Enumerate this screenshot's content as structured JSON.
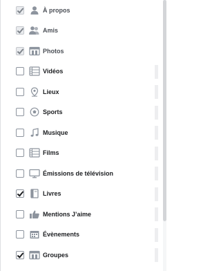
{
  "items": [
    {
      "label": "À propos",
      "checked": true,
      "locked": true,
      "icon": "person-icon"
    },
    {
      "label": "Amis",
      "checked": true,
      "locked": true,
      "icon": "friends-icon"
    },
    {
      "label": "Photos",
      "checked": true,
      "locked": true,
      "icon": "photos-icon"
    },
    {
      "label": "Vidéos",
      "checked": false,
      "locked": false,
      "icon": "film-strip-icon"
    },
    {
      "label": "Lieux",
      "checked": false,
      "locked": false,
      "icon": "map-pin-icon"
    },
    {
      "label": "Sports",
      "checked": false,
      "locked": false,
      "icon": "sports-ball-icon"
    },
    {
      "label": "Musique",
      "checked": false,
      "locked": false,
      "icon": "music-note-icon"
    },
    {
      "label": "Films",
      "checked": false,
      "locked": false,
      "icon": "film-strip-icon"
    },
    {
      "label": "Émissions de télévision",
      "checked": false,
      "locked": false,
      "icon": "tv-icon"
    },
    {
      "label": "Livres",
      "checked": true,
      "locked": false,
      "icon": "book-icon"
    },
    {
      "label": "Mentions J’aime",
      "checked": false,
      "locked": false,
      "icon": "like-icon"
    },
    {
      "label": "Évènements",
      "checked": false,
      "locked": false,
      "icon": "calendar-icon"
    },
    {
      "label": "Groupes",
      "checked": true,
      "locked": false,
      "icon": "groups-icon"
    }
  ]
}
